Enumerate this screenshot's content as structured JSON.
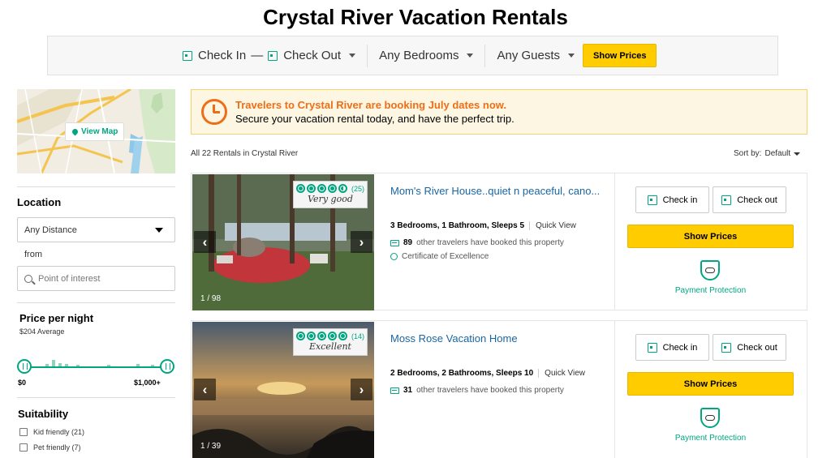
{
  "page": {
    "title": "Crystal River Vacation Rentals"
  },
  "search": {
    "check_in": "Check In",
    "dash": "—",
    "check_out": "Check Out",
    "bedrooms": "Any Bedrooms",
    "guests": "Any Guests",
    "show_prices": "Show Prices"
  },
  "sidebar": {
    "view_map": "View Map",
    "location_heading": "Location",
    "distance_value": "Any Distance",
    "from_label": "from",
    "poi_placeholder": "Point of interest",
    "price_heading": "Price per night",
    "price_average": "$204 Average",
    "price_min": "$0",
    "price_max": "$1,000+",
    "suitability_heading": "Suitability",
    "suitability_options": [
      {
        "label": "Kid friendly (21)"
      },
      {
        "label": "Pet friendly (7)"
      }
    ]
  },
  "banner": {
    "headline": "Travelers to Crystal River are booking July dates now.",
    "subtext": "Secure your vacation rental today, and have the perfect trip."
  },
  "results": {
    "count_text": "All 22 Rentals in Crystal River",
    "sort_label": "Sort by:",
    "sort_value": "Default"
  },
  "listings": [
    {
      "title": "Mom's River House..quiet n peaceful, cano...",
      "rating_count": "(25)",
      "rating_word": "Very good",
      "rating": 4.5,
      "image_index": "1 / 98",
      "specs": "3 Bedrooms, 1 Bathroom, Sleeps 5",
      "quick_view": "Quick View",
      "booked_count": "89",
      "booked_text": "other travelers have booked this property",
      "certificate": "Certificate of Excellence",
      "check_in": "Check in",
      "check_out": "Check out",
      "show_prices": "Show Prices",
      "payment_protection": "Payment Protection"
    },
    {
      "title": "Moss Rose Vacation Home",
      "rating_count": "(14)",
      "rating_word": "Excellent",
      "rating": 5,
      "image_index": "1 / 39",
      "specs": "2 Bedrooms, 2 Bathrooms, Sleeps 10",
      "quick_view": "Quick View",
      "booked_count": "31",
      "booked_text": "other travelers have booked this property",
      "check_in": "Check in",
      "check_out": "Check out",
      "show_prices": "Show Prices",
      "payment_protection": "Payment Protection"
    }
  ],
  "colors": {
    "accent": "#00a680",
    "button": "#ffcc00",
    "alert": "#ee6e18",
    "link": "#1a66a3"
  }
}
